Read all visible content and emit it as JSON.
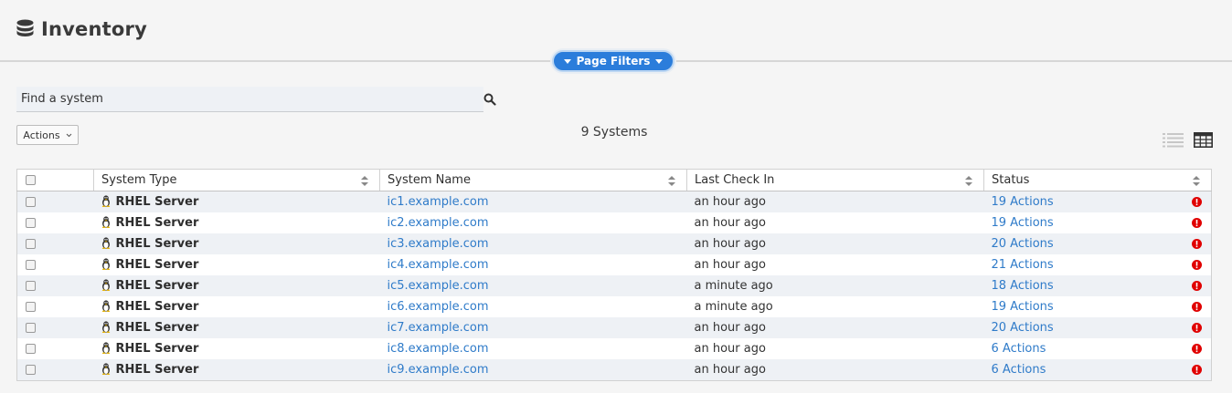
{
  "header": {
    "title": "Inventory",
    "title_icon": "database-icon"
  },
  "page_filters": {
    "label": "Page Filters"
  },
  "search": {
    "placeholder": "Find a system"
  },
  "toolbar": {
    "actions_label": "Actions",
    "system_count": "9 Systems"
  },
  "table": {
    "columns": [
      "System Type",
      "System Name",
      "Last Check In",
      "Status"
    ],
    "rows": [
      {
        "type": "RHEL Server",
        "name": "ic1.example.com",
        "checkin": "an hour ago",
        "status": "19 Actions"
      },
      {
        "type": "RHEL Server",
        "name": "ic2.example.com",
        "checkin": "an hour ago",
        "status": "19 Actions"
      },
      {
        "type": "RHEL Server",
        "name": "ic3.example.com",
        "checkin": "an hour ago",
        "status": "20 Actions"
      },
      {
        "type": "RHEL Server",
        "name": "ic4.example.com",
        "checkin": "an hour ago",
        "status": "21 Actions"
      },
      {
        "type": "RHEL Server",
        "name": "ic5.example.com",
        "checkin": "a minute ago",
        "status": "18 Actions"
      },
      {
        "type": "RHEL Server",
        "name": "ic6.example.com",
        "checkin": "a minute ago",
        "status": "19 Actions"
      },
      {
        "type": "RHEL Server",
        "name": "ic7.example.com",
        "checkin": "an hour ago",
        "status": "20 Actions"
      },
      {
        "type": "RHEL Server",
        "name": "ic8.example.com",
        "checkin": "an hour ago",
        "status": "6 Actions"
      },
      {
        "type": "RHEL Server",
        "name": "ic9.example.com",
        "checkin": "an hour ago",
        "status": "6 Actions"
      }
    ]
  },
  "colors": {
    "accent": "#2b7ddb",
    "link": "#2f7bc9",
    "alert": "#e00000"
  }
}
